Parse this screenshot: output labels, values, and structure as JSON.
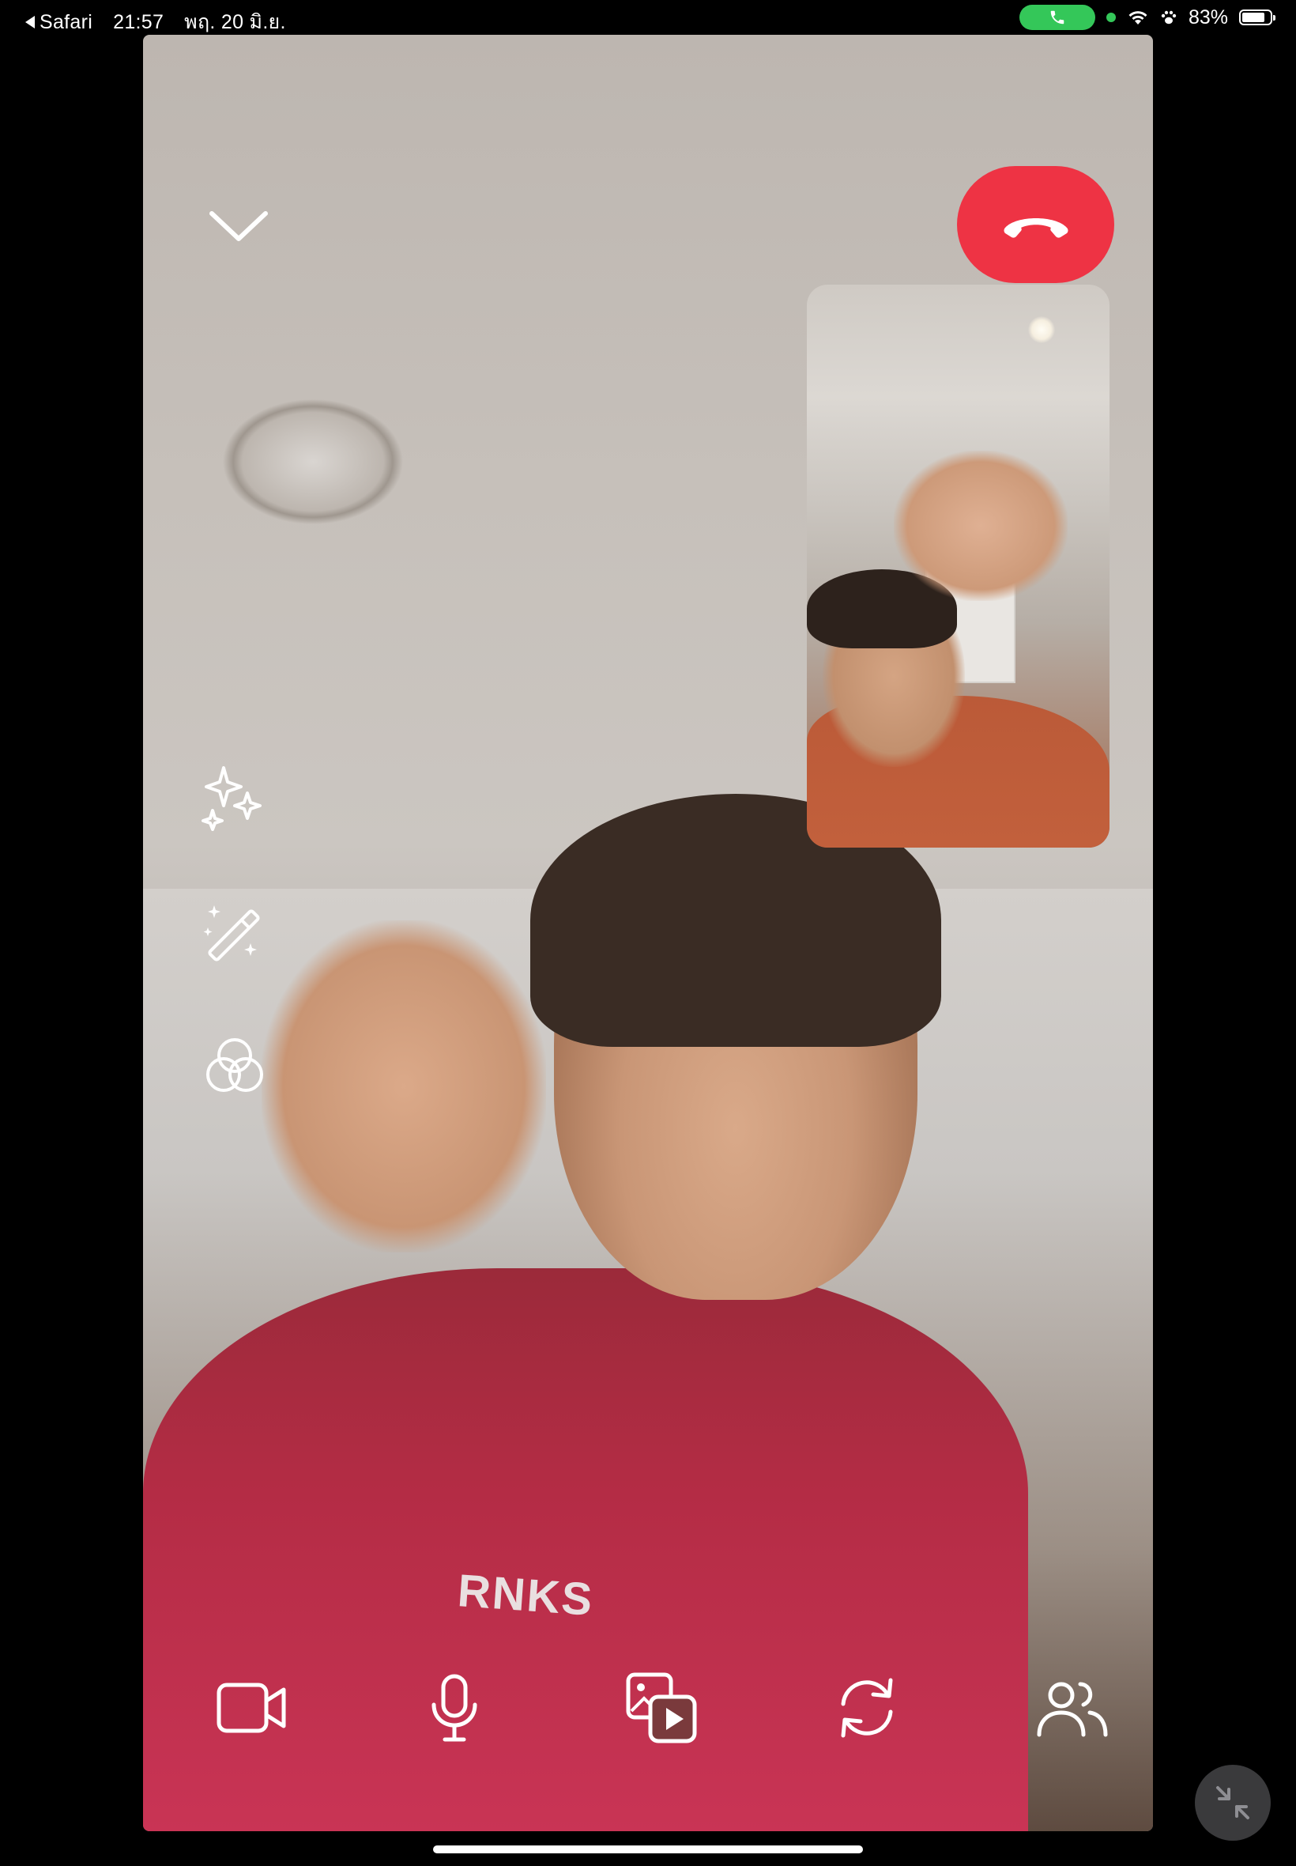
{
  "status_bar": {
    "back_app": "Safari",
    "time": "21:57",
    "date": "พฤ. 20 มิ.ย.",
    "battery": "83%",
    "battery_level": 0.83,
    "call_active_color": "#34c759",
    "icons": [
      "back-triangle-icon",
      "phone-icon",
      "camera-in-use-dot-icon",
      "wifi-icon",
      "paw-icon",
      "battery-icon"
    ]
  },
  "call": {
    "collapse_icon": "chevron-down-icon",
    "end_call_icon": "phone-hangup-icon",
    "end_call_color": "#ee3344",
    "side_tools": [
      {
        "name": "effects",
        "icon": "sparkles-icon"
      },
      {
        "name": "magic",
        "icon": "magic-wand-icon"
      },
      {
        "name": "filters",
        "icon": "color-filter-icon"
      }
    ],
    "bottom_controls": [
      {
        "name": "camera",
        "icon": "video-camera-icon"
      },
      {
        "name": "microphone",
        "icon": "microphone-icon"
      },
      {
        "name": "share-media",
        "icon": "media-play-icon"
      },
      {
        "name": "flip-camera",
        "icon": "flip-camera-icon"
      },
      {
        "name": "participants",
        "icon": "people-icon"
      }
    ],
    "minimize_icon": "minimize-arrows-icon",
    "main_video_shirt_text": "RNKS"
  }
}
